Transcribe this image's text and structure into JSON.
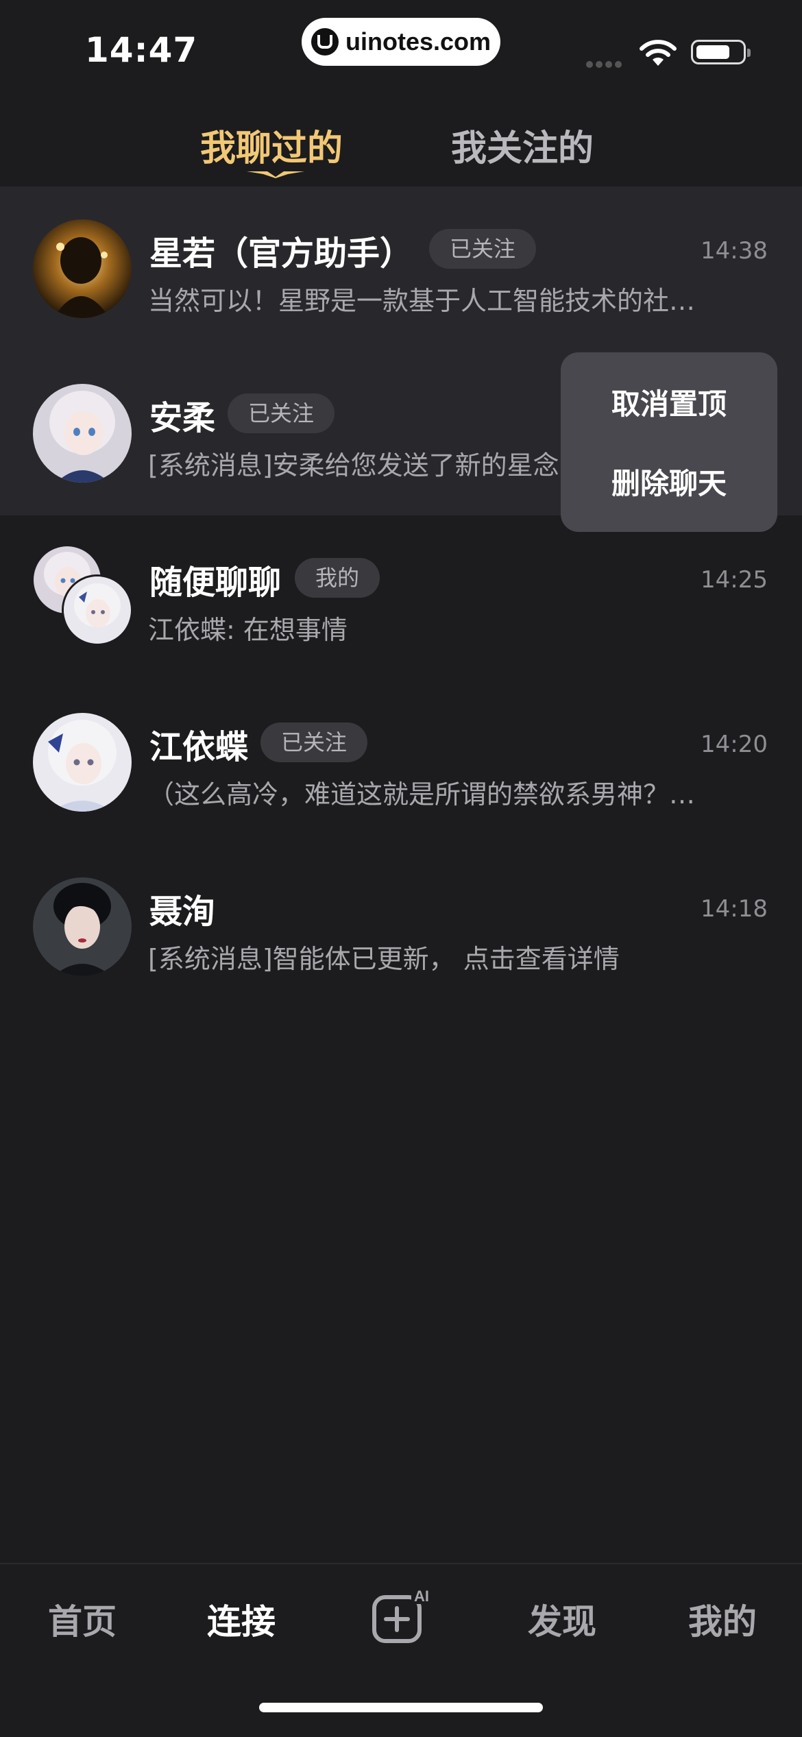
{
  "status_bar": {
    "time": "14:47",
    "watermark": "uinotes.com"
  },
  "tabs": [
    {
      "label": "我聊过的",
      "active": true
    },
    {
      "label": "我关注的",
      "active": false
    }
  ],
  "chats": [
    {
      "name": "星若（官方助手）",
      "badge": "已关注",
      "time": "14:38",
      "preview": "当然可以！星野是一款基于人工智能技术的社…",
      "pinned": true
    },
    {
      "name": "安柔",
      "badge": "已关注",
      "time": "",
      "preview": "[系统消息]安柔给您发送了新的星念",
      "pinned": true
    },
    {
      "name": "随便聊聊",
      "badge": "我的",
      "time": "14:25",
      "preview": "江依蝶: 在想事情",
      "pinned": false
    },
    {
      "name": "江依蝶",
      "badge": "已关注",
      "time": "14:20",
      "preview": "（这么高冷，难道这就是所谓的禁欲系男神？…",
      "pinned": false
    },
    {
      "name": "聂洵",
      "badge": "",
      "time": "14:18",
      "preview": "[系统消息]智能体已更新， 点击查看详情",
      "pinned": false
    }
  ],
  "context_menu": {
    "items": [
      "取消置顶",
      "删除聊天"
    ]
  },
  "bottom_nav": {
    "items": [
      "首页",
      "连接",
      "发现",
      "我的"
    ],
    "active": "连接",
    "center_label": "AI"
  },
  "colors": {
    "accent": "#f2c875",
    "background": "#1c1c1e",
    "pinned_row": "#28282c",
    "menu": "#48484e"
  }
}
